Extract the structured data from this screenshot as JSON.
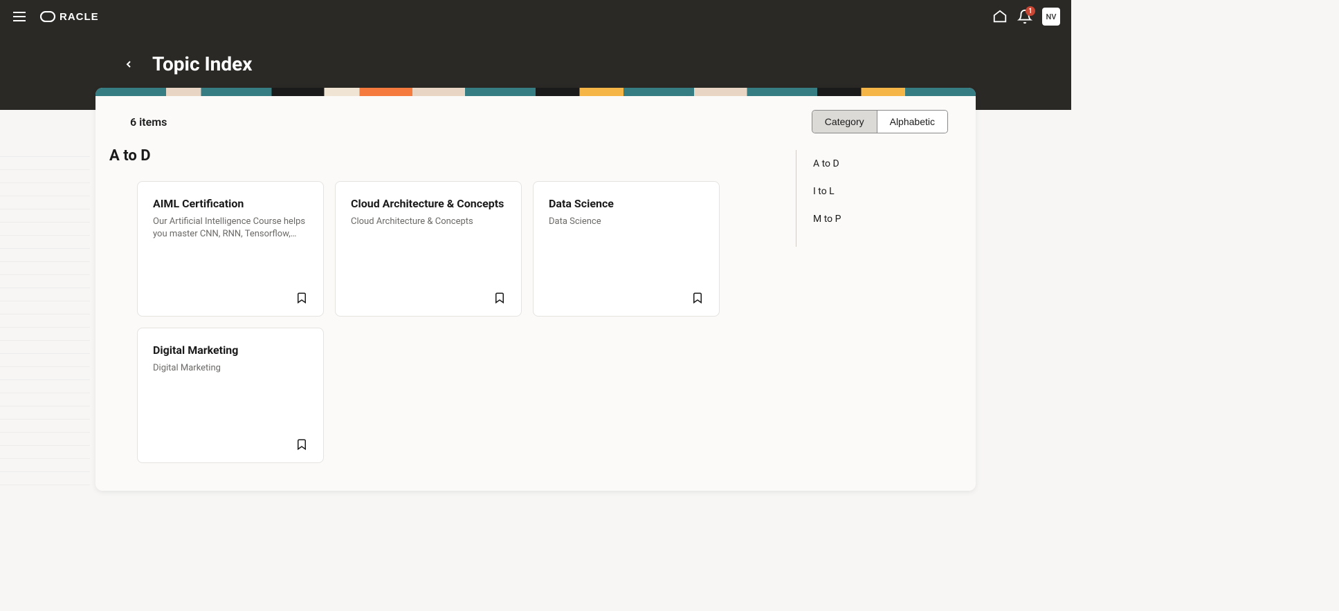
{
  "header": {
    "brand": "ORACLE",
    "notification_count": "1",
    "avatar_initials": "NV"
  },
  "page": {
    "title": "Topic Index",
    "items_count": "6 items"
  },
  "toggle": {
    "option_a": "Category",
    "option_b": "Alphabetic"
  },
  "section": {
    "heading": "A to D"
  },
  "cards": [
    {
      "title": "AIML Certification",
      "desc": "Our Artificial Intelligence Course helps you master CNN, RNN, Tensorflow,…"
    },
    {
      "title": "Cloud Architecture & Concepts",
      "desc": "Cloud Architecture & Concepts"
    },
    {
      "title": "Data Science",
      "desc": "Data Science"
    },
    {
      "title": "Digital Marketing",
      "desc": "Digital Marketing"
    }
  ],
  "nav_links": [
    "A to D",
    "I to L",
    "M to P"
  ]
}
